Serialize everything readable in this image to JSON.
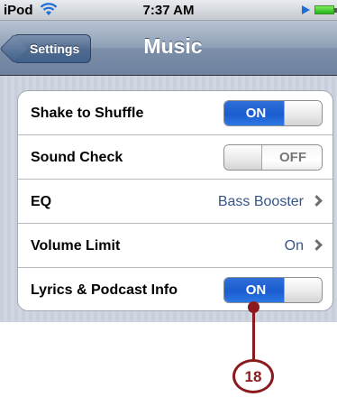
{
  "status_bar": {
    "carrier": "iPod",
    "time": "7:37 AM",
    "icons": [
      "wifi-icon",
      "play-icon",
      "battery-icon"
    ]
  },
  "nav_bar": {
    "back_label": "Settings",
    "title": "Music"
  },
  "settings": [
    {
      "label": "Shake to Shuffle",
      "type": "toggle",
      "state": "ON"
    },
    {
      "label": "Sound Check",
      "type": "toggle",
      "state": "OFF"
    },
    {
      "label": "EQ",
      "type": "disclosure",
      "value": "Bass Booster"
    },
    {
      "label": "Volume Limit",
      "type": "disclosure",
      "value": "On"
    },
    {
      "label": "Lyrics & Podcast Info",
      "type": "toggle",
      "state": "ON"
    }
  ],
  "callout": {
    "number": "18"
  },
  "colors": {
    "toggle_on": "#1a5ccf",
    "value_text": "#385487",
    "callout": "#8b1a1f",
    "nav_bar": "#6d82a0"
  }
}
